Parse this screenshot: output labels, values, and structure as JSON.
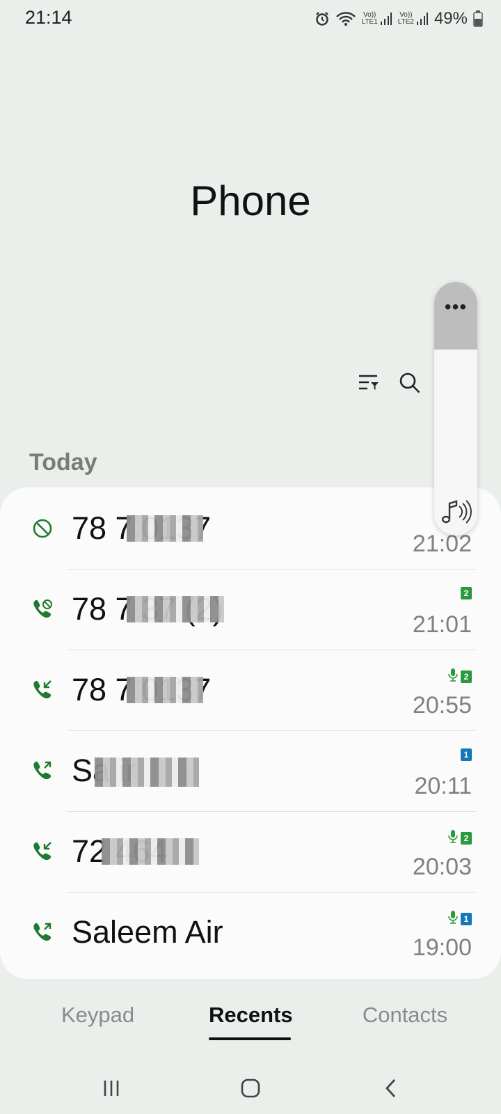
{
  "status": {
    "time": "21:14",
    "sim1_label_top": "Vo))",
    "sim1_label_bottom": "LTE1",
    "sim2_label_top": "Vo))",
    "sim2_label_bottom": "LTE2",
    "battery": "49%"
  },
  "app": {
    "title": "Phone"
  },
  "toolbar": {
    "filter_icon": "filter-icon",
    "search_icon": "search-icon"
  },
  "section": {
    "today": "Today"
  },
  "calls": [
    {
      "name": "78 7   0137",
      "time": "21:02",
      "type": "blocked",
      "badges": []
    },
    {
      "name": "78 7   37 (2)",
      "time": "21:01",
      "type": "missed",
      "badges": [
        {
          "kind": "sim",
          "label": "2",
          "color": "#2a9a3c"
        }
      ]
    },
    {
      "name": "78 7   0137",
      "time": "20:55",
      "type": "incoming",
      "badges": [
        {
          "kind": "mic"
        },
        {
          "kind": "sim",
          "label": "2",
          "color": "#2a9a3c"
        }
      ]
    },
    {
      "name": "Sa   ir",
      "time": "20:11",
      "type": "outgoing",
      "badges": [
        {
          "kind": "sim",
          "label": "1",
          "color": "#1477b8"
        }
      ]
    },
    {
      "name": "72   464",
      "time": "20:03",
      "type": "incoming",
      "badges": [
        {
          "kind": "mic"
        },
        {
          "kind": "sim",
          "label": "2",
          "color": "#2a9a3c"
        }
      ]
    },
    {
      "name": "Saleem Air",
      "time": "19:00",
      "type": "outgoing",
      "badges": [
        {
          "kind": "mic"
        },
        {
          "kind": "sim",
          "label": "1",
          "color": "#1477b8"
        }
      ]
    }
  ],
  "tabs": [
    {
      "label": "Keypad",
      "active": false
    },
    {
      "label": "Recents",
      "active": true
    },
    {
      "label": "Contacts",
      "active": false
    }
  ],
  "colors": {
    "call_icon_green": "#1f7a2f",
    "background": "#ebefeb",
    "card": "#fbfbfb"
  }
}
